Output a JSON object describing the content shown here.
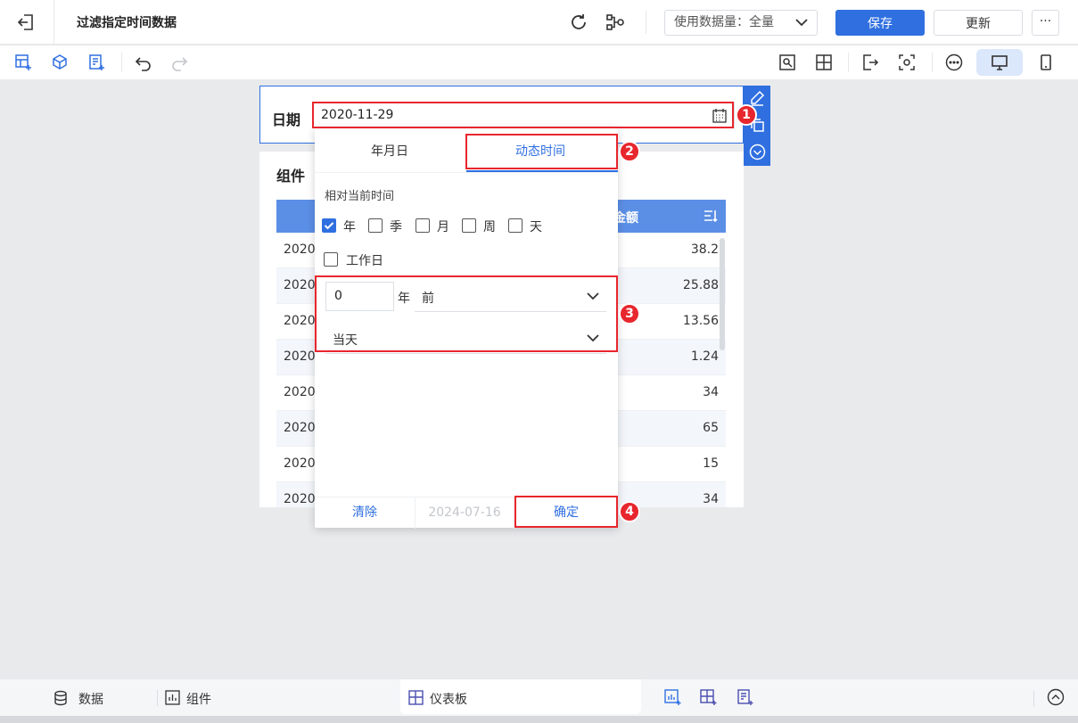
{
  "topbar": {
    "title": "过滤指定时间数据",
    "usage_label": "使用数据量：全量",
    "save_label": "保存",
    "update_label": "更新",
    "more_label": "···"
  },
  "filter": {
    "label": "日期",
    "date_value": "2020-11-29"
  },
  "table": {
    "title": "组件",
    "amount_header": "金额",
    "rows": [
      {
        "date": "2020-",
        "amount": "38.2"
      },
      {
        "date": "2020-",
        "amount": "25.88"
      },
      {
        "date": "2020-",
        "amount": "13.56"
      },
      {
        "date": "2020-",
        "amount": "1.24"
      },
      {
        "date": "2020-",
        "amount": "34"
      },
      {
        "date": "2020-",
        "amount": "65"
      },
      {
        "date": "2020-",
        "amount": "15"
      },
      {
        "date": "2020-",
        "amount": "34"
      }
    ]
  },
  "popup": {
    "tab_date": "年月日",
    "tab_dynamic": "动态时间",
    "relative_label": "相对当前时间",
    "checkboxes": [
      {
        "label": "年",
        "checked": true
      },
      {
        "label": "季",
        "checked": false
      },
      {
        "label": "月",
        "checked": false
      },
      {
        "label": "周",
        "checked": false
      },
      {
        "label": "天",
        "checked": false
      }
    ],
    "workday_label": "工作日",
    "offset_value": "0",
    "offset_unit": "年",
    "direction_value": "前",
    "anchor_value": "当天",
    "clear_label": "清除",
    "today_date": "2024-07-16",
    "confirm_label": "确定"
  },
  "markers": [
    "1",
    "2",
    "3",
    "4"
  ],
  "bottombar": {
    "data_label": "数据",
    "component_label": "组件",
    "dashboard_label": "仪表板"
  },
  "colors": {
    "accent": "#2f6fe0",
    "annotation": "#e8262d",
    "table_header": "#5b8fe6"
  }
}
